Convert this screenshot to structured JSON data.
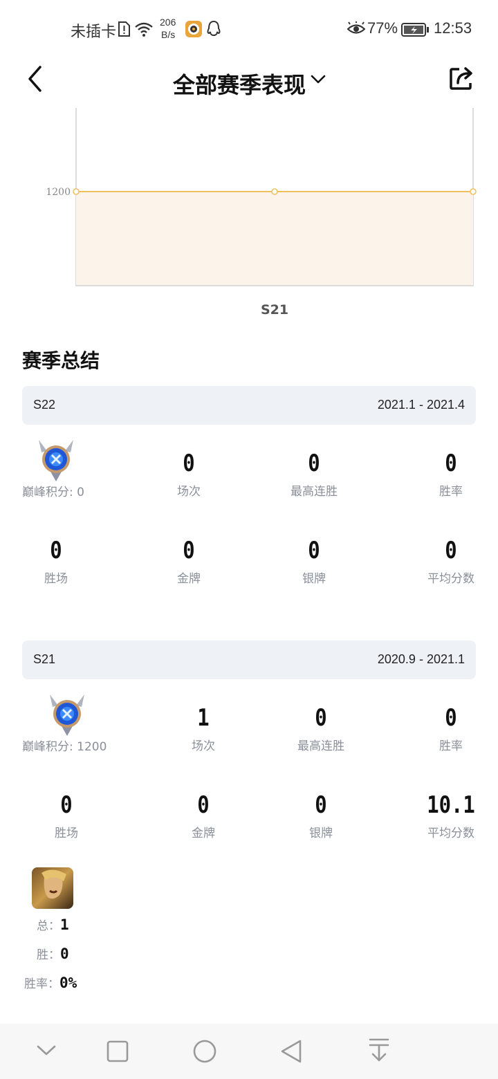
{
  "status_bar": {
    "carrier": "未插卡",
    "net_speed_top": "206",
    "net_speed_bottom": "B/s",
    "battery": "77%",
    "time": "12:53"
  },
  "nav": {
    "title": "全部赛季表现"
  },
  "chart_data": {
    "type": "area",
    "x": [
      "",
      "S21",
      ""
    ],
    "series": [
      {
        "values": [
          1200,
          1200,
          1200
        ]
      }
    ],
    "y_tick_labels": [
      "1200"
    ],
    "xlabel_center": "S21",
    "color": "#f0c060",
    "fill": "#fcf3ea"
  },
  "summary": {
    "title": "赛季总结",
    "seasons": [
      {
        "name": "S22",
        "range": "2021.1 - 2021.4",
        "peak_label": "巅峰积分: 0",
        "stats_row1": [
          {
            "value": "0",
            "label": "场次"
          },
          {
            "value": "0",
            "label": "最高连胜"
          },
          {
            "value": "0",
            "label": "胜率"
          }
        ],
        "stats_row2": [
          {
            "value": "0",
            "label": "胜场"
          },
          {
            "value": "0",
            "label": "金牌"
          },
          {
            "value": "0",
            "label": "银牌"
          },
          {
            "value": "0",
            "label": "平均分数"
          }
        ]
      },
      {
        "name": "S21",
        "range": "2020.9 - 2021.1",
        "peak_label": "巅峰积分: 1200",
        "stats_row1": [
          {
            "value": "1",
            "label": "场次"
          },
          {
            "value": "0",
            "label": "最高连胜"
          },
          {
            "value": "0",
            "label": "胜率"
          }
        ],
        "stats_row2": [
          {
            "value": "0",
            "label": "胜场"
          },
          {
            "value": "0",
            "label": "金牌"
          },
          {
            "value": "0",
            "label": "银牌"
          },
          {
            "value": "10.1",
            "label": "平均分数"
          }
        ],
        "hero": {
          "total_label": "总：",
          "total_value": "1",
          "win_label": "胜：",
          "win_value": "0",
          "rate_label": "胜率：",
          "rate_value": "0%"
        }
      }
    ]
  },
  "colors": {
    "accent_line": "#f0c060",
    "season_bar_bg": "#eef1f6",
    "label_gray": "#8a8f99"
  }
}
